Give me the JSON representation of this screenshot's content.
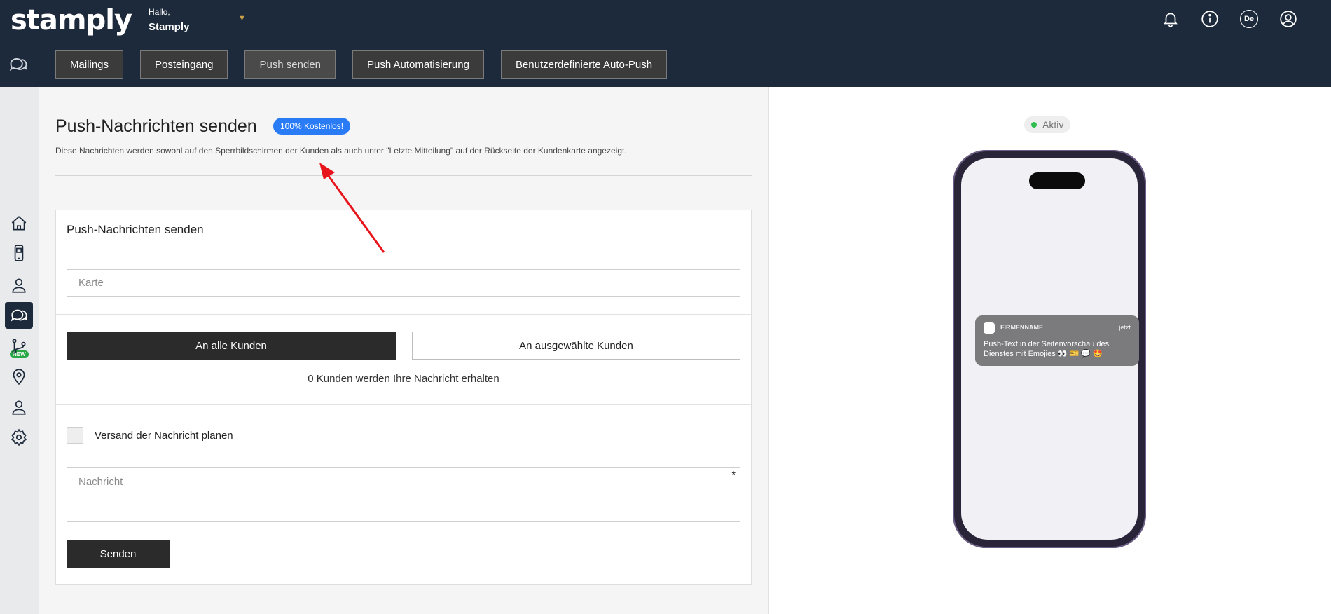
{
  "header": {
    "logo": "stamply",
    "greeting": "Hallo,",
    "user_name": "Stamply",
    "language": "De",
    "icons": [
      "bell-icon",
      "info-icon",
      "language-icon",
      "user-icon"
    ]
  },
  "tabs": [
    {
      "label": "Mailings"
    },
    {
      "label": "Posteingang"
    },
    {
      "label": "Push senden"
    },
    {
      "label": "Push Automatisierung"
    },
    {
      "label": "Benutzerdefinierte Auto-Push"
    }
  ],
  "sidebar": {
    "new_badge": "NEW",
    "items": [
      "home-icon",
      "mobile-card-icon",
      "customers-icon",
      "messages-icon",
      "flow-icon",
      "location-icon",
      "account-icon",
      "settings-icon"
    ]
  },
  "main": {
    "title": "Push-Nachrichten senden",
    "badge": "100% Kostenlos!",
    "description": "Diese Nachrichten werden sowohl auf den Sperrbildschirmen der Kunden als auch unter \"Letzte Mitteilung\" auf der Rückseite der Kundenkarte angezeigt.",
    "card": {
      "title": "Push-Nachrichten senden",
      "card_placeholder": "Karte",
      "all_customers_label": "An alle Kunden",
      "selected_customers_label": "An ausgewählte Kunden",
      "recipients_text": "0 Kunden werden Ihre Nachricht erhalten",
      "schedule_label": "Versand der Nachricht planen",
      "message_placeholder": "Nachricht",
      "required_mark": "*",
      "send_label": "Senden"
    }
  },
  "preview": {
    "status": "Aktiv",
    "notification": {
      "app_name": "FIRMENNAME",
      "time": "jetzt",
      "text": "Push-Text in der Seitenvorschau des Dienstes mit Emojies 👀 🎫 💬 🤩"
    }
  },
  "colors": {
    "header_bg": "#1d2a3b",
    "badge_blue": "#2a7cf6",
    "active_green": "#2ebd4e",
    "arrow_red": "#e8141c"
  }
}
